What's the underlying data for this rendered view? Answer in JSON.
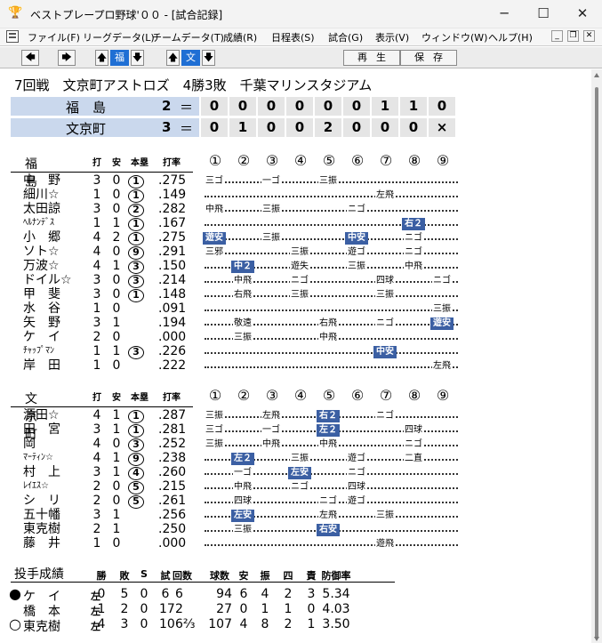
{
  "window": {
    "title": "ベストプレープロ野球'００ - [試合記録]",
    "app_icon": "trophy-icon",
    "controls": {
      "minimize": "─",
      "maximize": "☐",
      "close": "✕"
    }
  },
  "menu": {
    "items": [
      "ファイル(F)",
      "リーグデータ(L)",
      "チームデータ(T)",
      "成績(R)",
      "日程表(S)",
      "試合(G)",
      "表示(V)",
      "ウィンドウ(W)",
      "ヘルプ(H)"
    ]
  },
  "toolbar": {
    "team_away": "福",
    "team_home": "文",
    "play_label": "再生",
    "save_label": "保存"
  },
  "game": {
    "round": "7回戦",
    "header": "文京町アストロズ　4勝3敗　千葉マリンスタジアム"
  },
  "scoreboard": [
    {
      "team": "福　島",
      "runs": "2",
      "eq": "＝",
      "innings": [
        "0",
        "0",
        "0",
        "0",
        "0",
        "0",
        "1",
        "1",
        "0"
      ]
    },
    {
      "team": "文京町",
      "runs": "3",
      "eq": "＝",
      "innings": [
        "0",
        "1",
        "0",
        "0",
        "2",
        "0",
        "0",
        "0",
        "×"
      ]
    }
  ],
  "batting_headers": {
    "ab": "打",
    "h": "安",
    "hr": "本塁",
    "avg": "打率"
  },
  "inning_labels": [
    "①",
    "②",
    "③",
    "④",
    "⑤",
    "⑥",
    "⑦",
    "⑧",
    "⑨"
  ],
  "away": {
    "team": "福　島",
    "players": [
      {
        "name": "中　野",
        "ab": "3",
        "h": "0",
        "hr": "1",
        "avg": ".275",
        "res": [
          {
            "i": 0,
            "t": "三ゴ"
          },
          {
            "i": 2,
            "t": "一ゴ"
          },
          {
            "i": 4,
            "t": "三振"
          }
        ]
      },
      {
        "name": "細川☆",
        "ab": "1",
        "h": "0",
        "hr": "1",
        "avg": ".149",
        "res": [
          {
            "i": 6,
            "t": "左飛"
          }
        ]
      },
      {
        "name": "太田諒",
        "ab": "3",
        "h": "0",
        "hr": "2",
        "avg": ".282",
        "res": [
          {
            "i": 0,
            "t": "中飛"
          },
          {
            "i": 2,
            "t": "三振"
          },
          {
            "i": 5,
            "t": "ニゴ"
          }
        ]
      },
      {
        "name": "ﾍﾙﾅﾝﾃﾞｽ",
        "ab": "1",
        "h": "1",
        "hr": "1",
        "avg": ".167",
        "res": [
          {
            "i": 7,
            "t": "右２",
            "hl": true
          }
        ]
      },
      {
        "name": "小　郷",
        "ab": "4",
        "h": "2",
        "hr": "1",
        "avg": ".275",
        "res": [
          {
            "i": 0,
            "t": "遊安",
            "hl": true
          },
          {
            "i": 2,
            "t": "三振"
          },
          {
            "i": 5,
            "t": "中安",
            "hl": true
          },
          {
            "i": 7,
            "t": "ニゴ"
          }
        ]
      },
      {
        "name": "ソト☆",
        "ab": "4",
        "h": "0",
        "hr": "9",
        "avg": ".291",
        "res": [
          {
            "i": 0,
            "t": "三邪"
          },
          {
            "i": 3,
            "t": "三振"
          },
          {
            "i": 5,
            "t": "遊ゴ"
          },
          {
            "i": 7,
            "t": "ニゴ"
          }
        ]
      },
      {
        "name": "万波☆",
        "ab": "4",
        "h": "1",
        "hr": "3",
        "avg": ".150",
        "res": [
          {
            "i": 1,
            "t": "中２",
            "hl": true
          },
          {
            "i": 3,
            "t": "遊失"
          },
          {
            "i": 5,
            "t": "三振"
          },
          {
            "i": 7,
            "t": "中飛"
          }
        ]
      },
      {
        "name": "ドイル☆",
        "ab": "3",
        "h": "0",
        "hr": "3",
        "avg": ".214",
        "res": [
          {
            "i": 1,
            "t": "中飛"
          },
          {
            "i": 3,
            "t": "ニゴ"
          },
          {
            "i": 6,
            "t": "四球"
          },
          {
            "i": 8,
            "t": "ニゴ"
          }
        ]
      },
      {
        "name": "甲　斐",
        "ab": "3",
        "h": "0",
        "hr": "1",
        "avg": ".148",
        "res": [
          {
            "i": 1,
            "t": "右飛"
          },
          {
            "i": 3,
            "t": "三振"
          },
          {
            "i": 6,
            "t": "三振"
          }
        ]
      },
      {
        "name": "水　谷",
        "ab": "1",
        "h": "0",
        "hr": "",
        "avg": ".091",
        "res": [
          {
            "i": 8,
            "t": "三振"
          }
        ]
      },
      {
        "name": "矢　野",
        "ab": "3",
        "h": "1",
        "hr": "",
        "avg": ".194",
        "res": [
          {
            "i": 1,
            "t": "敬遠"
          },
          {
            "i": 4,
            "t": "右飛"
          },
          {
            "i": 6,
            "t": "ニゴ"
          },
          {
            "i": 8,
            "t": "遊安",
            "hl": true
          }
        ]
      },
      {
        "name": "ケ　イ",
        "ab": "2",
        "h": "0",
        "hr": "",
        "avg": ".000",
        "res": [
          {
            "i": 1,
            "t": "三振"
          },
          {
            "i": 4,
            "t": "中飛"
          }
        ]
      },
      {
        "name": "ﾁｬｯﾌﾟﾏﾝ",
        "ab": "1",
        "h": "1",
        "hr": "3",
        "avg": ".226",
        "res": [
          {
            "i": 6,
            "t": "中安",
            "hl": true
          }
        ]
      },
      {
        "name": "岸　田",
        "ab": "1",
        "h": "0",
        "hr": "",
        "avg": ".222",
        "res": [
          {
            "i": 8,
            "t": "左飛"
          }
        ]
      }
    ]
  },
  "home": {
    "team": "文京町",
    "players": [
      {
        "name": "源田☆",
        "ab": "4",
        "h": "1",
        "hr": "1",
        "avg": ".287",
        "res": [
          {
            "i": 0,
            "t": "三振"
          },
          {
            "i": 2,
            "t": "左飛"
          },
          {
            "i": 4,
            "t": "右２",
            "hl": true
          },
          {
            "i": 6,
            "t": "ニゴ"
          }
        ]
      },
      {
        "name": "田　宮",
        "ab": "3",
        "h": "1",
        "hr": "1",
        "avg": ".281",
        "res": [
          {
            "i": 0,
            "t": "三ゴ"
          },
          {
            "i": 2,
            "t": "一ゴ"
          },
          {
            "i": 4,
            "t": "左２",
            "hl": true
          },
          {
            "i": 7,
            "t": "四球"
          }
        ]
      },
      {
        "name": "岡",
        "ab": "4",
        "h": "0",
        "hr": "3",
        "avg": ".252",
        "res": [
          {
            "i": 0,
            "t": "三振"
          },
          {
            "i": 2,
            "t": "中飛"
          },
          {
            "i": 4,
            "t": "中飛"
          },
          {
            "i": 7,
            "t": "ニゴ"
          }
        ]
      },
      {
        "name": "ﾏｰﾃｨﾝ☆",
        "ab": "4",
        "h": "1",
        "hr": "9",
        "avg": ".238",
        "res": [
          {
            "i": 1,
            "t": "左２",
            "hl": true
          },
          {
            "i": 3,
            "t": "三振"
          },
          {
            "i": 5,
            "t": "遊ゴ"
          },
          {
            "i": 7,
            "t": "二直"
          }
        ]
      },
      {
        "name": "村　上",
        "ab": "3",
        "h": "1",
        "hr": "4",
        "avg": ".260",
        "res": [
          {
            "i": 1,
            "t": "一ゴ"
          },
          {
            "i": 3,
            "t": "左安",
            "hl": true
          },
          {
            "i": 5,
            "t": "ニゴ"
          }
        ]
      },
      {
        "name": "ﾚｲｴｽ☆",
        "ab": "2",
        "h": "0",
        "hr": "5",
        "avg": ".215",
        "res": [
          {
            "i": 1,
            "t": "中飛"
          },
          {
            "i": 3,
            "t": "ニゴ"
          },
          {
            "i": 5,
            "t": "四球"
          }
        ]
      },
      {
        "name": "シ　リ",
        "ab": "2",
        "h": "0",
        "hr": "5",
        "avg": ".261",
        "res": [
          {
            "i": 1,
            "t": "四球"
          },
          {
            "i": 4,
            "t": "ニゴ"
          },
          {
            "i": 5,
            "t": "遊ゴ"
          }
        ]
      },
      {
        "name": "五十幡",
        "ab": "3",
        "h": "1",
        "hr": "",
        "avg": ".256",
        "res": [
          {
            "i": 1,
            "t": "左安",
            "hl": true
          },
          {
            "i": 4,
            "t": "左飛"
          },
          {
            "i": 6,
            "t": "三振"
          }
        ]
      },
      {
        "name": "東克樹",
        "ab": "2",
        "h": "1",
        "hr": "",
        "avg": ".250",
        "res": [
          {
            "i": 1,
            "t": "三振"
          },
          {
            "i": 4,
            "t": "右安",
            "hl": true
          }
        ]
      },
      {
        "name": "藤　井",
        "ab": "1",
        "h": "0",
        "hr": "",
        "avg": ".000",
        "res": [
          {
            "i": 6,
            "t": "遊飛"
          }
        ]
      }
    ]
  },
  "pitching": {
    "title": "投手成績",
    "headers": [
      "勝",
      "敗",
      "S",
      "試",
      "回数",
      "球数",
      "安",
      "振",
      "四",
      "責",
      "防御率"
    ],
    "rows": [
      {
        "mark": "●",
        "name": "ケ　イ",
        "hand": "左",
        "w": "0",
        "l": "5",
        "s": "0",
        "g": "6",
        "ip": "6",
        "np": "94",
        "h": "6",
        "k": "4",
        "bb": "2",
        "er": "3",
        "era": "5.34"
      },
      {
        "mark": "",
        "name": "橋　本",
        "hand": "左",
        "w": "1",
        "l": "2",
        "s": "0",
        "g": "17",
        "ip": "2",
        "np": "27",
        "h": "0",
        "k": "1",
        "bb": "1",
        "er": "0",
        "era": "4.03"
      },
      {
        "mark": "○",
        "name": "東克樹",
        "hand": "左",
        "w": "4",
        "l": "3",
        "s": "0",
        "g": "10",
        "ip": "6⅔",
        "np": "107",
        "h": "4",
        "k": "8",
        "bb": "2",
        "er": "1",
        "era": "3.50"
      }
    ]
  }
}
